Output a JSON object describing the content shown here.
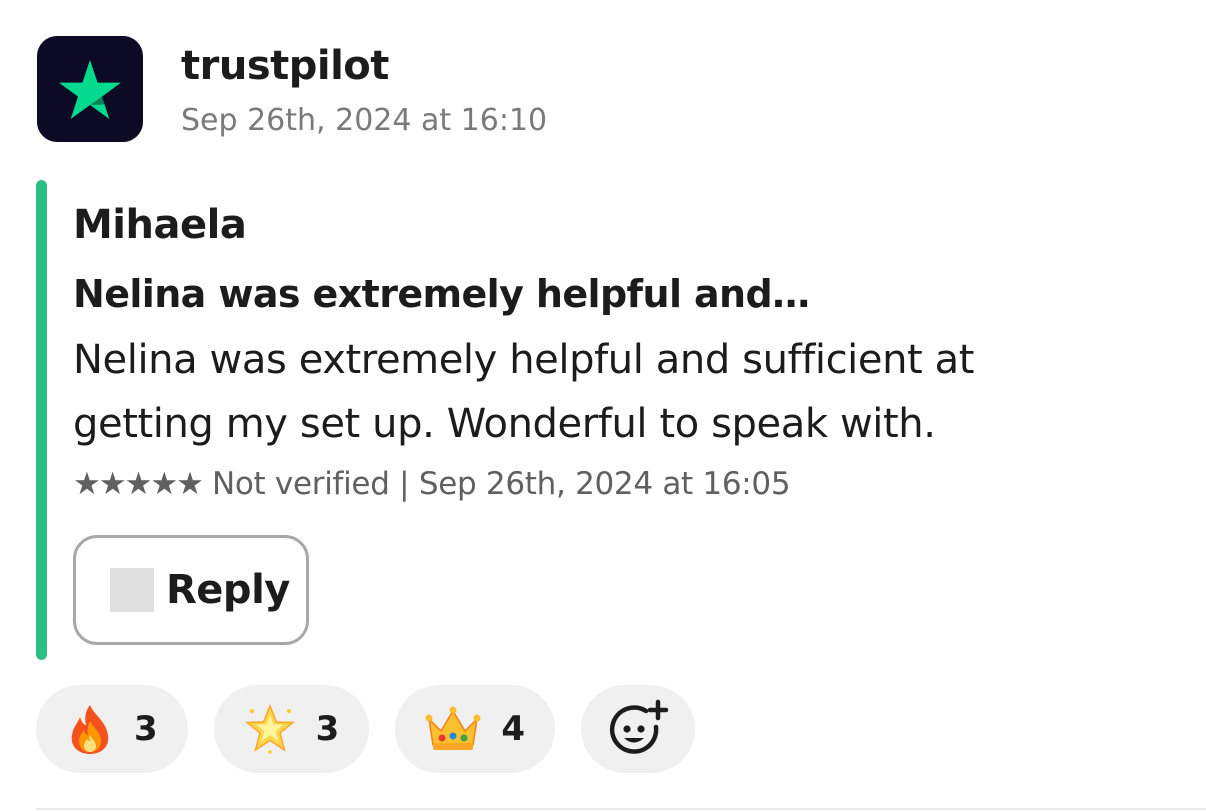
{
  "message": {
    "sender": "trustpilot",
    "timestamp": "Sep 26th, 2024 at 16:10",
    "avatar_icon": "star-icon",
    "avatar_bg": "#0c0a24",
    "avatar_star_color": "#04da8d"
  },
  "review": {
    "accent_color": "#2ebd85",
    "reviewer": "Mihaela",
    "title": "Nelina was extremely helpful and…",
    "text_line_1": "Nelina was extremely helpful and sufficient at",
    "text_line_2": "getting my set up. Wonderful to speak with.",
    "stars": "★★★★★",
    "rating": 5,
    "meta": "Not verified | Sep 26th, 2024 at 16:05"
  },
  "reply_button": {
    "label": "Reply"
  },
  "reactions": [
    {
      "icon": "fire-emoji",
      "count": "3"
    },
    {
      "icon": "glowing-star-emoji",
      "count": "3"
    },
    {
      "icon": "crown-emoji",
      "count": "4"
    }
  ],
  "add_reaction": {
    "icon": "add-reaction-icon"
  }
}
